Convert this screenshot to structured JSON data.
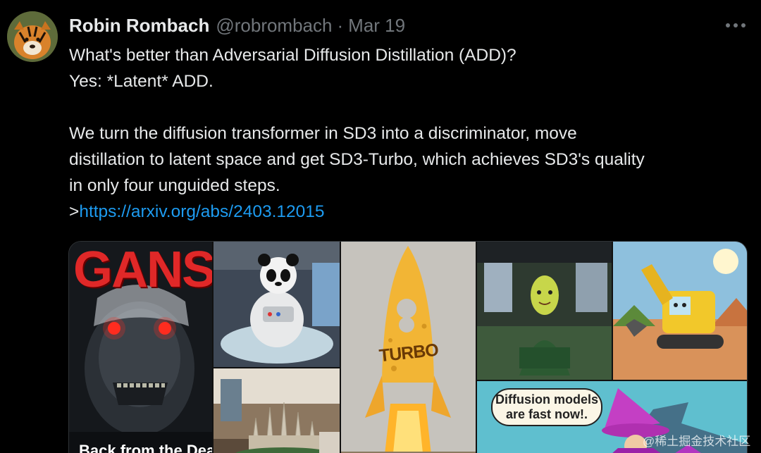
{
  "tweet": {
    "author_name": "Robin Rombach",
    "handle": "@robrombach",
    "separator": "·",
    "date": "Mar 19",
    "lines": [
      "What's better than Adversarial Diffusion Distillation (ADD)?",
      "Yes:  *Latent* ADD.",
      "",
      "We turn the diffusion transformer in SD3 into a discriminator, move",
      "distillation to latent space and get SD3-Turbo, which achieves SD3's quality",
      "in only four unguided steps."
    ],
    "link_prefix": ">",
    "link_text": "https://arxiv.org/abs/2403.12015"
  },
  "media": {
    "gans_title": "GANS",
    "gans_subtitle": "Back from the Dead",
    "rocket_label": "TURBO",
    "bubble_line1": "Diffusion models",
    "bubble_line2": "are fast now!."
  },
  "watermark": "@稀土掘金技术社区",
  "icons": {
    "more": "more-horizontal-icon"
  },
  "colors": {
    "background": "#000000",
    "text": "#e7e9ea",
    "secondary": "#71767b",
    "link": "#1d9bf0"
  }
}
